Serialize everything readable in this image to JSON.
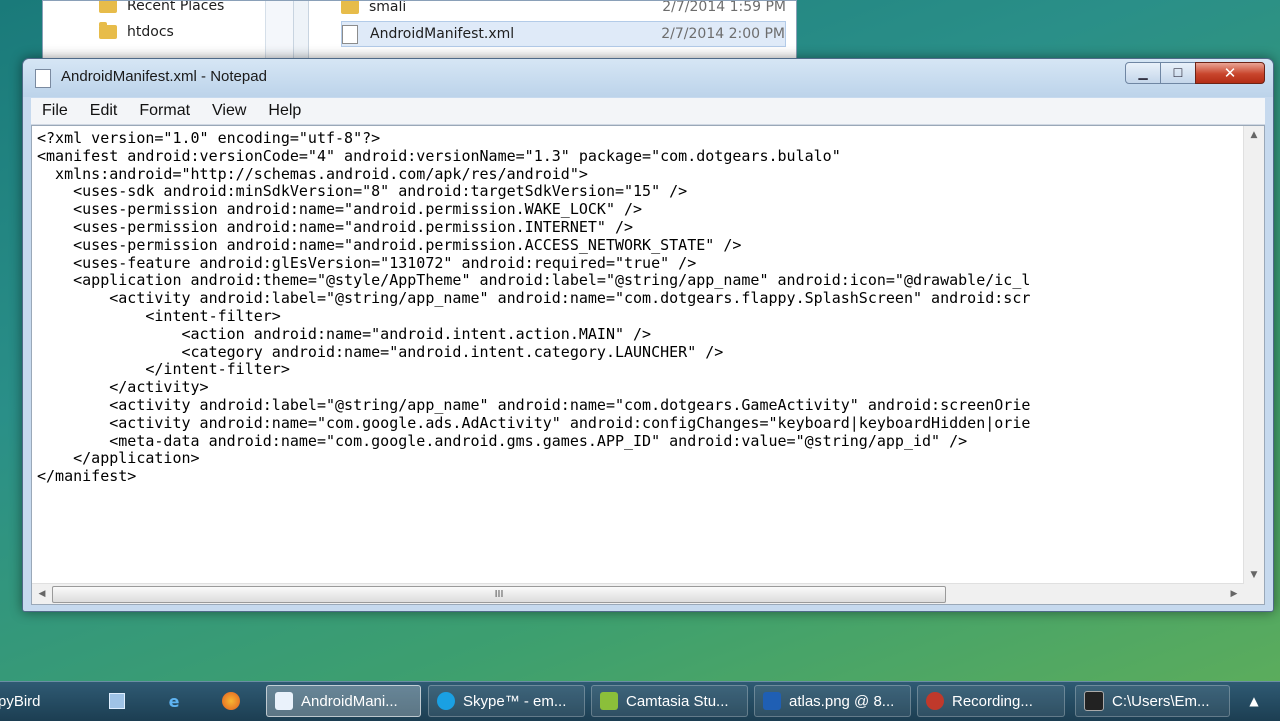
{
  "explorer": {
    "nav_items": [
      {
        "label": "Recent Places"
      },
      {
        "label": "htdocs"
      }
    ],
    "files": [
      {
        "name": "smali",
        "date": "2/7/2014 1:59 PM"
      },
      {
        "name": "AndroidManifest.xml",
        "date": "2/7/2014 2:00 PM"
      }
    ]
  },
  "notepad": {
    "title": "AndroidManifest.xml - Notepad",
    "menu": [
      "File",
      "Edit",
      "Format",
      "View",
      "Help"
    ],
    "content": "<?xml version=\"1.0\" encoding=\"utf-8\"?>\n<manifest android:versionCode=\"4\" android:versionName=\"1.3\" package=\"com.dotgears.bulalo\"\n  xmlns:android=\"http://schemas.android.com/apk/res/android\">\n    <uses-sdk android:minSdkVersion=\"8\" android:targetSdkVersion=\"15\" />\n    <uses-permission android:name=\"android.permission.WAKE_LOCK\" />\n    <uses-permission android:name=\"android.permission.INTERNET\" />\n    <uses-permission android:name=\"android.permission.ACCESS_NETWORK_STATE\" />\n    <uses-feature android:glEsVersion=\"131072\" android:required=\"true\" />\n    <application android:theme=\"@style/AppTheme\" android:label=\"@string/app_name\" android:icon=\"@drawable/ic_l\n        <activity android:label=\"@string/app_name\" android:name=\"com.dotgears.flappy.SplashScreen\" android:scr\n            <intent-filter>\n                <action android:name=\"android.intent.action.MAIN\" />\n                <category android:name=\"android.intent.category.LAUNCHER\" />\n            </intent-filter>\n        </activity>\n        <activity android:label=\"@string/app_name\" android:name=\"com.dotgears.GameActivity\" android:screenOrie\n        <activity android:name=\"com.google.ads.AdActivity\" android:configChanges=\"keyboard|keyboardHidden|orie\n        <meta-data android:name=\"com.google.android.gms.games.APP_ID\" android:value=\"@string/app_id\" />\n    </application>\n</manifest>",
    "hscroll_grip": "III"
  },
  "taskbar": {
    "items": [
      {
        "label": "pyBird",
        "color": "#2d6ea3"
      },
      {
        "label": "AndroidMani...",
        "color": "#eaf2fb",
        "active": true
      },
      {
        "label": "Skype™ - em...",
        "color": "#1aa0e3"
      },
      {
        "label": "Camtasia Stu...",
        "color": "#8bbf3a"
      },
      {
        "label": "atlas.png @ 8...",
        "color": "#1f5fb4"
      },
      {
        "label": "Recording...",
        "color": "#c0392b"
      },
      {
        "label": "C:\\Users\\Em...",
        "color": "#222222"
      }
    ]
  }
}
